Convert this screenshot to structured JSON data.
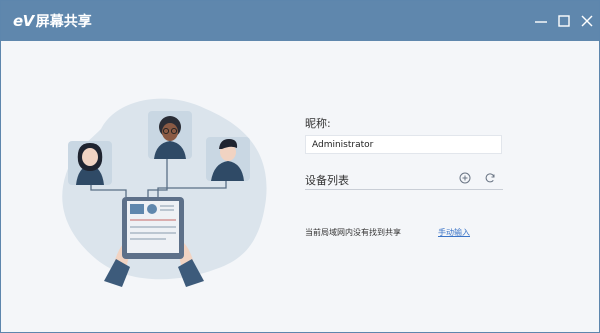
{
  "titlebar": {
    "logo_mark": "eV",
    "title": "屏幕共享",
    "minimize_icon": "minimize-icon",
    "maximize_icon": "maximize-icon",
    "close_icon": "close-icon"
  },
  "form": {
    "nickname_label": "昵称:",
    "nickname_value": "Administrator",
    "device_list_label": "设备列表",
    "add_icon": "plus-circle-icon",
    "refresh_icon": "refresh-icon",
    "empty_message": "当前局域网内没有找到共享",
    "manual_input_link": "手动输入"
  },
  "colors": {
    "titlebar": "#5f87ad",
    "background": "#f4f6f9",
    "link": "#3b74c7",
    "blob": "#dbe4ec"
  }
}
